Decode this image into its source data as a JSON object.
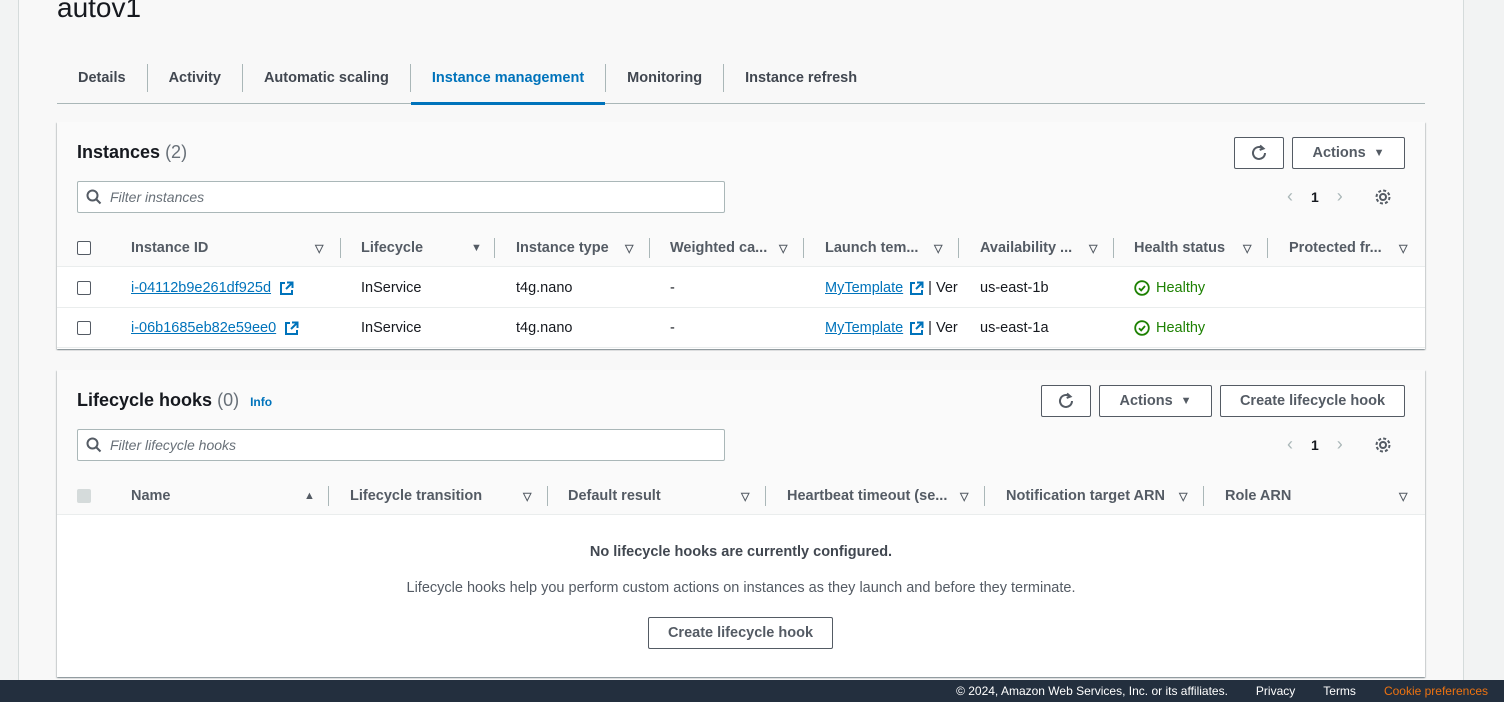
{
  "page": {
    "title": "autov1"
  },
  "tabs": [
    {
      "label": "Details"
    },
    {
      "label": "Activity"
    },
    {
      "label": "Automatic scaling"
    },
    {
      "label": "Instance management",
      "active": true
    },
    {
      "label": "Monitoring"
    },
    {
      "label": "Instance refresh"
    }
  ],
  "instances": {
    "title": "Instances",
    "count": "(2)",
    "actions_label": "Actions",
    "search_placeholder": "Filter instances",
    "page_number": "1",
    "columns": [
      "Instance ID",
      "Lifecycle",
      "Instance type",
      "Weighted ca...",
      "Launch tem...",
      "Availability ...",
      "Health status",
      "Protected fr..."
    ],
    "rows": [
      {
        "instance_id": "i-04112b9e261df925d",
        "lifecycle": "InService",
        "instance_type": "t4g.nano",
        "weighted": "-",
        "launch_template": "MyTemplate",
        "launch_suffix": "| Ver",
        "az": "us-east-1b",
        "health": "Healthy"
      },
      {
        "instance_id": "i-06b1685eb82e59ee0",
        "lifecycle": "InService",
        "instance_type": "t4g.nano",
        "weighted": "-",
        "launch_template": "MyTemplate",
        "launch_suffix": "| Ver",
        "az": "us-east-1a",
        "health": "Healthy"
      }
    ]
  },
  "hooks": {
    "title": "Lifecycle hooks",
    "count": "(0)",
    "info_label": "Info",
    "actions_label": "Actions",
    "create_label": "Create lifecycle hook",
    "search_placeholder": "Filter lifecycle hooks",
    "page_number": "1",
    "columns": [
      "Name",
      "Lifecycle transition",
      "Default result",
      "Heartbeat timeout (se...",
      "Notification target ARN",
      "Role ARN"
    ],
    "empty_title": "No lifecycle hooks are currently configured.",
    "empty_desc": "Lifecycle hooks help you perform custom actions on instances as they launch and before they terminate.",
    "empty_button": "Create lifecycle hook"
  },
  "footer": {
    "copyright": "© 2024, Amazon Web Services, Inc. or its affiliates.",
    "privacy": "Privacy",
    "terms": "Terms",
    "cookie": "Cookie preferences"
  },
  "colors": {
    "accent": "#0073bb",
    "healthy": "#1d8102",
    "footer_bg": "#232f3e",
    "cookie": "#ec7211"
  }
}
